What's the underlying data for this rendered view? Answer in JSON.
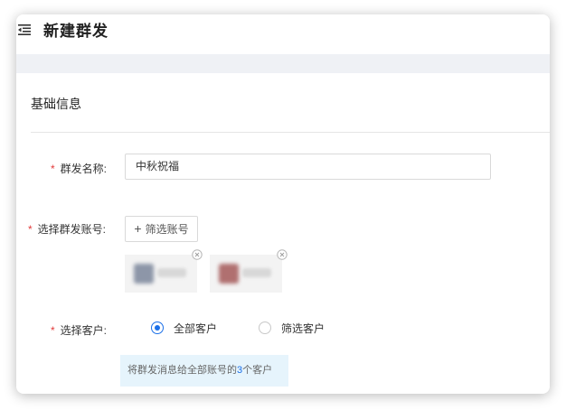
{
  "header": {
    "title": "新建群发",
    "menu_icon": "menu-fold-icon"
  },
  "section": {
    "title": "基础信息"
  },
  "form": {
    "required_mark": "*",
    "name_label": "群发名称:",
    "name_value": "中秋祝福",
    "account_label": "选择群发账号:",
    "filter_account_button": "筛选账号",
    "filter_account_button_icon": "plus-icon",
    "accounts_note": "two selected accounts shown with blurred avatar and name, each with a remove button",
    "customer_label": "选择客户:",
    "customer_options": [
      {
        "label": "全部客户",
        "checked": true
      },
      {
        "label": "筛选客户",
        "checked": false
      }
    ],
    "hint_prefix": "将群发消息给全部账号的",
    "hint_count": "3",
    "hint_suffix": "个客户"
  },
  "colors": {
    "accent": "#1a6fe8",
    "required": "#e23b3b",
    "band": "#eff1f5",
    "hint_bg": "#e6f4fc"
  }
}
